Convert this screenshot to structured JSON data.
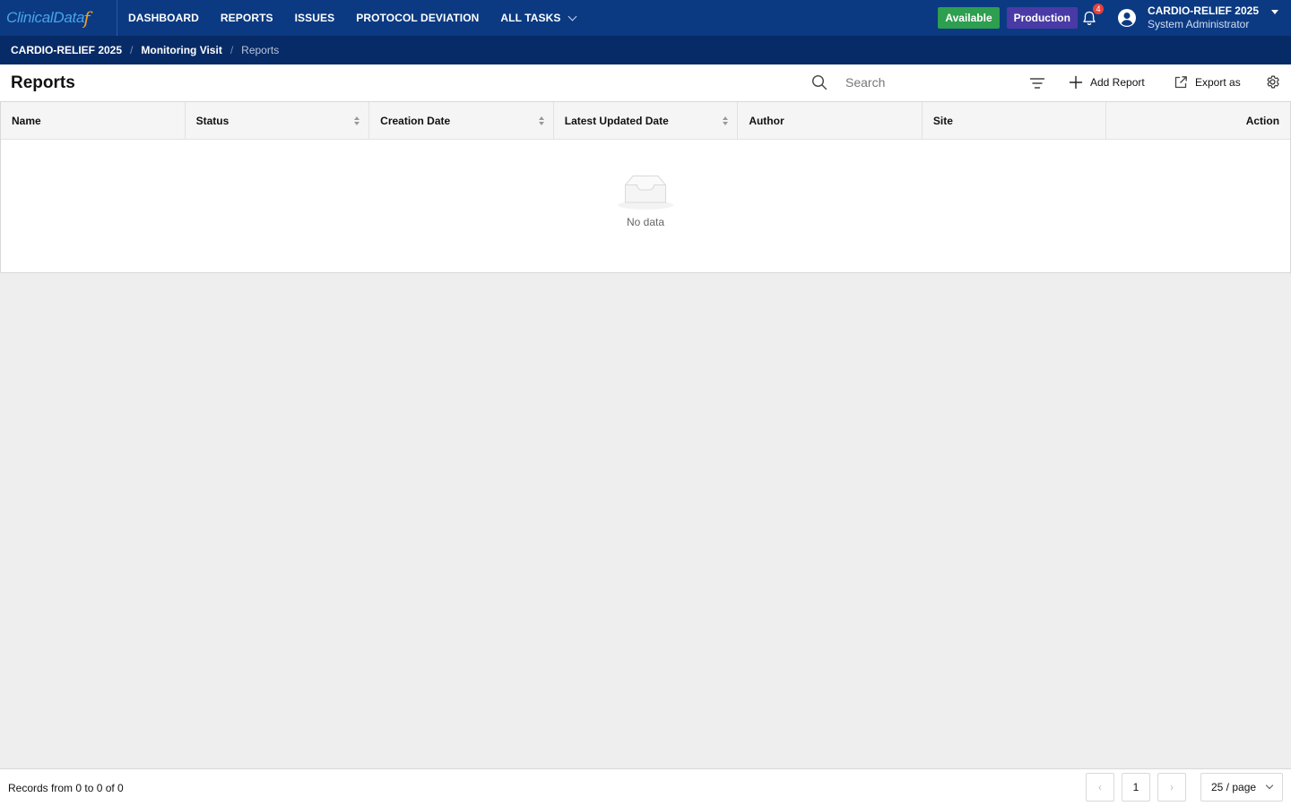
{
  "app": {
    "logo_text": "ClinicalData",
    "logo_mark": "f"
  },
  "nav": {
    "items": [
      {
        "label": "DASHBOARD"
      },
      {
        "label": "REPORTS"
      },
      {
        "label": "ISSUES"
      },
      {
        "label": "PROTOCOL DEVIATION"
      },
      {
        "label": "ALL TASKS"
      }
    ]
  },
  "status": {
    "available": "Available",
    "environment": "Production",
    "notification_count": "4"
  },
  "user": {
    "study": "CARDIO-RELIEF 2025",
    "role": "System Administrator"
  },
  "breadcrumb": {
    "items": [
      "CARDIO-RELIEF 2025",
      "Monitoring Visit",
      "Reports"
    ],
    "separator": "/"
  },
  "toolbar": {
    "title": "Reports",
    "search_placeholder": "Search",
    "add_label": "Add Report",
    "export_label": "Export as"
  },
  "table": {
    "columns": [
      {
        "label": "Name"
      },
      {
        "label": "Status"
      },
      {
        "label": "Creation Date"
      },
      {
        "label": "Latest Updated Date"
      },
      {
        "label": "Author"
      },
      {
        "label": "Site"
      },
      {
        "label": "Action"
      }
    ],
    "rows": [],
    "empty_text": "No data"
  },
  "footer": {
    "records_text": "Records from 0 to 0 of 0",
    "current_page": "1",
    "page_size": "25 / page",
    "prev": "‹",
    "next": "›"
  },
  "colors": {
    "topbar": "#0b3a82",
    "breadcrumb_bar": "#072b66",
    "available": "#2e9e4f",
    "production": "#4a3aa6",
    "notification": "#e8413c"
  }
}
